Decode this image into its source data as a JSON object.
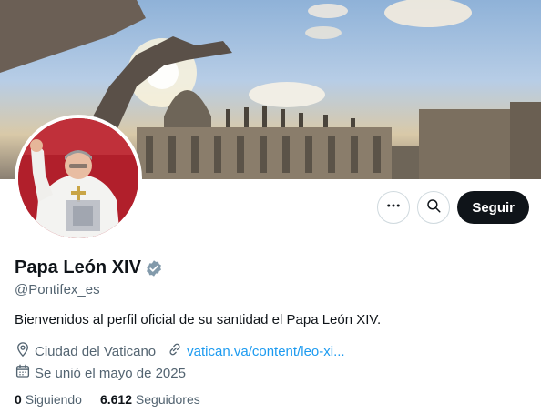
{
  "profile": {
    "name": "Papa León XIV",
    "handle": "@Pontifex_es",
    "bio": "Bienvenidos al perfil oficial de su santidad el Papa León XIV.",
    "location": "Ciudad del Vaticano",
    "website": "vatican.va/content/leo-xi...",
    "joined": "Se unió el mayo de 2025",
    "following_count": "0",
    "following_label": "Siguiendo",
    "followers_count": "6.612",
    "followers_label": "Seguidores"
  },
  "actions": {
    "follow_label": "Seguir",
    "more_icon": "more-dots-icon",
    "search_icon": "search-icon"
  },
  "colors": {
    "accent": "#1d9bf0",
    "verified": "#829aab",
    "text": "#0f1419",
    "muted": "#536471",
    "button_dark": "#0f1419"
  }
}
